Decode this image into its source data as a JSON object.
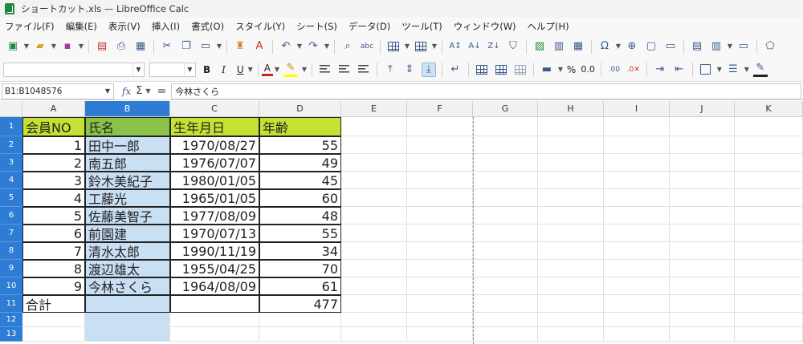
{
  "window": {
    "title": "ショートカット.xls — LibreOffice Calc"
  },
  "menu": [
    "ファイル(F)",
    "編集(E)",
    "表示(V)",
    "挿入(I)",
    "書式(O)",
    "スタイル(Y)",
    "シート(S)",
    "データ(D)",
    "ツール(T)",
    "ウィンドウ(W)",
    "ヘルプ(H)"
  ],
  "toolbar": {
    "bold": "B",
    "italic": "I",
    "underline": "U",
    "font_color": "A",
    "percent": "%",
    "decimal": "0.0"
  },
  "formula_bar": {
    "name_box": "B1:B1048576",
    "fx": "fx",
    "sigma": "Σ",
    "equals": "=",
    "content": "今林さくら"
  },
  "grid": {
    "columns": [
      "A",
      "B",
      "C",
      "D",
      "E",
      "F",
      "G",
      "H",
      "I",
      "J",
      "K"
    ],
    "selected_column": "B",
    "rows": [
      "1",
      "2",
      "3",
      "4",
      "5",
      "6",
      "7",
      "8",
      "9",
      "10",
      "11",
      "12",
      "13"
    ],
    "header": [
      "会員NO",
      "氏名",
      "生年月日",
      "年齢"
    ],
    "data": [
      [
        "1",
        "田中一郎",
        "1970/08/27",
        "55"
      ],
      [
        "2",
        "南五郎",
        "1976/07/07",
        "49"
      ],
      [
        "3",
        "鈴木美紀子",
        "1980/01/05",
        "45"
      ],
      [
        "4",
        "工藤光",
        "1965/01/05",
        "60"
      ],
      [
        "5",
        "佐藤美智子",
        "1977/08/09",
        "48"
      ],
      [
        "6",
        "前園建",
        "1970/07/13",
        "55"
      ],
      [
        "7",
        "清水太郎",
        "1990/11/19",
        "34"
      ],
      [
        "8",
        "渡辺雄太",
        "1955/04/25",
        "70"
      ],
      [
        "9",
        "今林さくら",
        "1964/08/09",
        "61"
      ]
    ],
    "total_label": "合計",
    "total_value": "477"
  },
  "colors": {
    "header_yellow": "#c6e033",
    "header_green": "#8bc34a",
    "selection": "#2e7cd3",
    "selected_column_fill": "#c9dff4"
  }
}
